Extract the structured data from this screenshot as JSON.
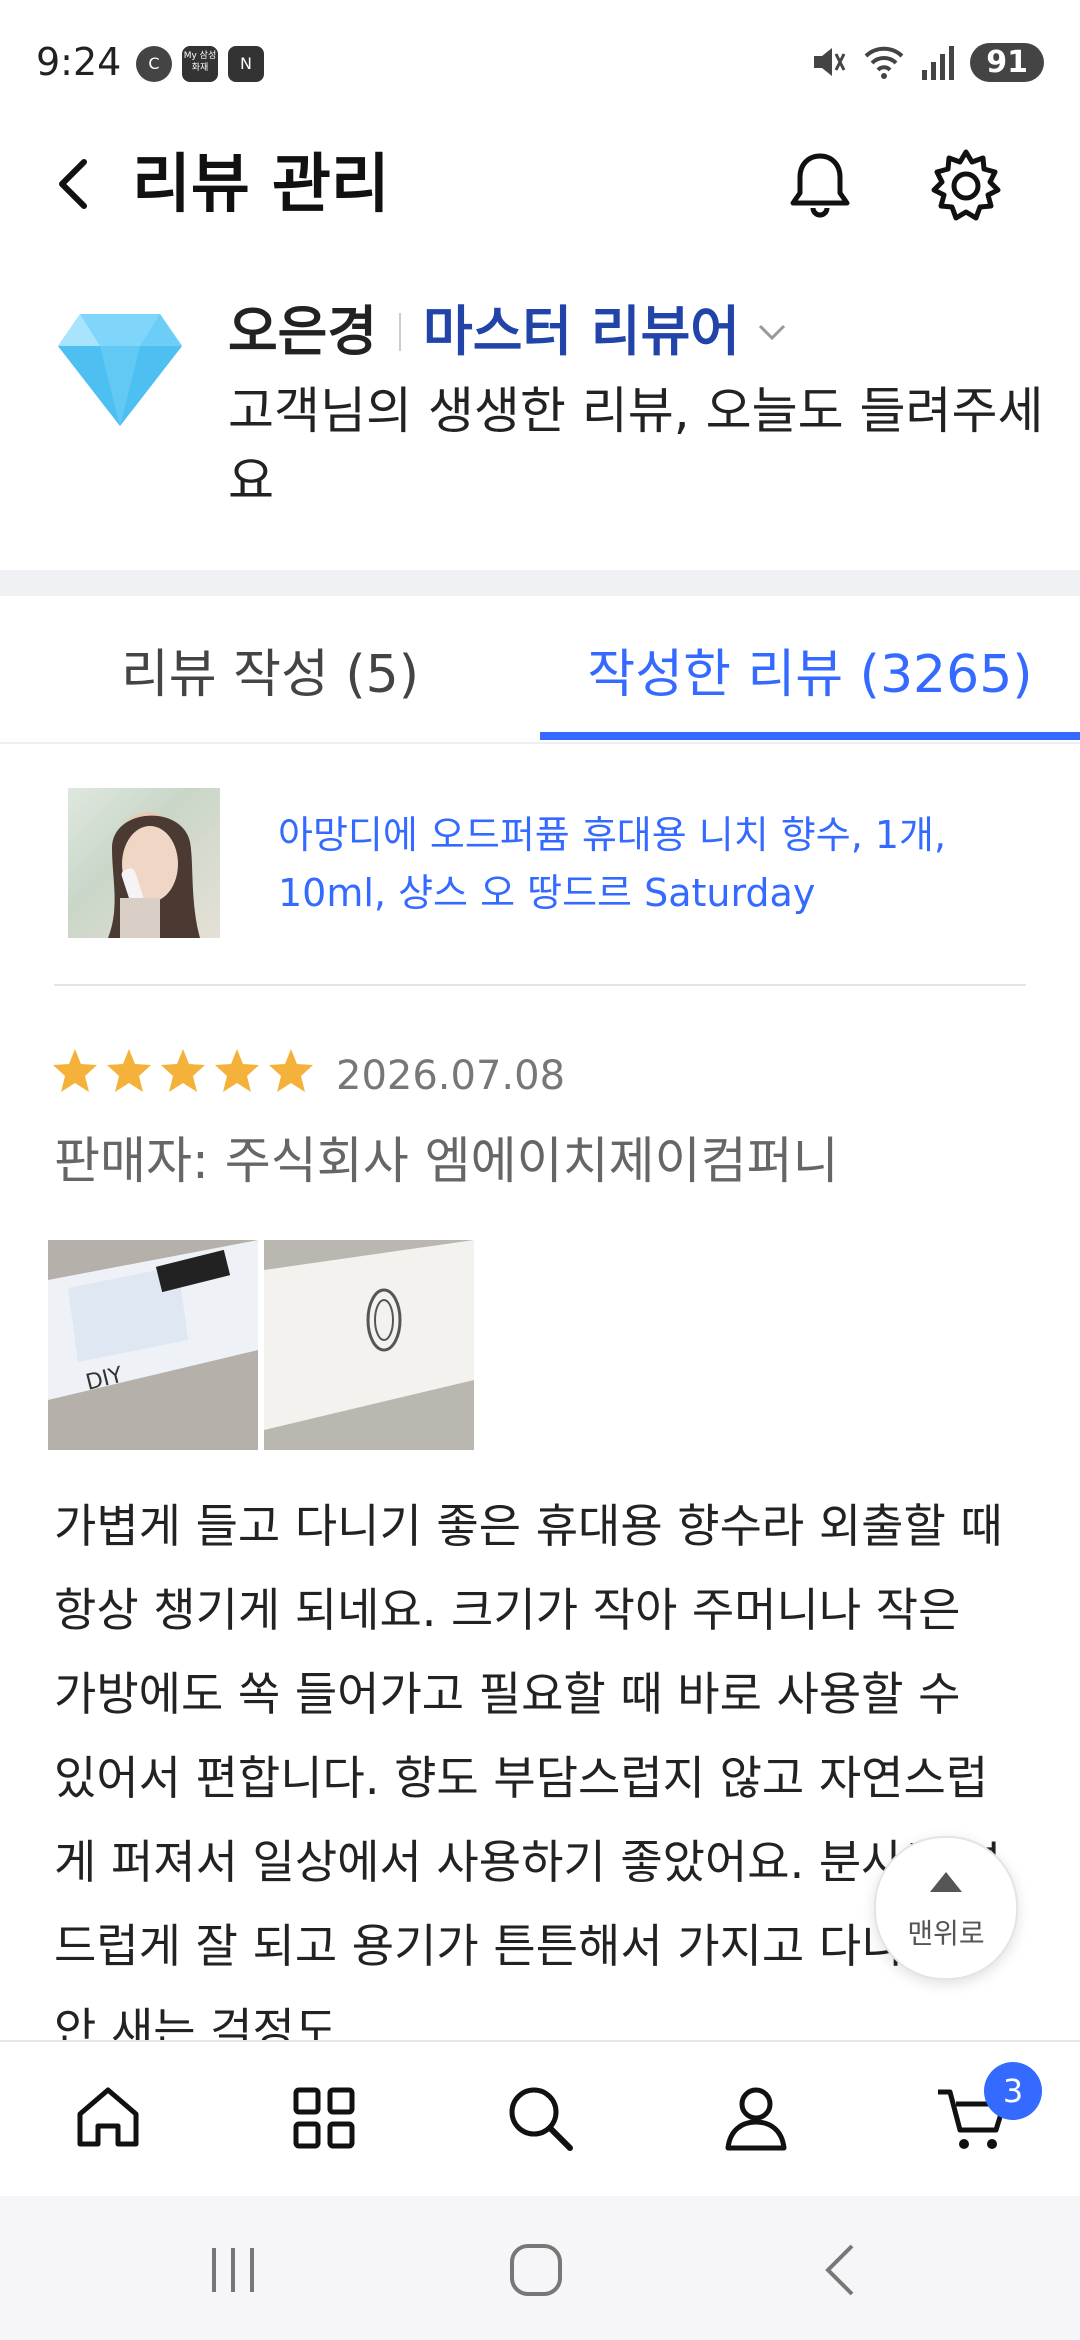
{
  "status_bar": {
    "time": "9:24",
    "badges": [
      "C",
      "My 삼성화재",
      "N"
    ],
    "battery": "91"
  },
  "header": {
    "title": "리뷰 관리",
    "icons": [
      "back-icon",
      "bell-icon",
      "gear-icon"
    ]
  },
  "profile": {
    "name": "오은경",
    "grade": "마스터 리뷰어",
    "message": "고객님의 생생한 리뷰, 오늘도 들려주세요",
    "grade_icon": "diamond-icon"
  },
  "tabs": [
    {
      "label": "리뷰 작성 (5)",
      "active": false
    },
    {
      "label": "작성한 리뷰 (3265)",
      "active": true
    }
  ],
  "review": {
    "product_name": "아망디에 오드퍼퓸 휴대용 니치 향수, 1개, 10ml, 샹스 오 땅드르 Saturday",
    "rating": 5,
    "date": "2026.07.08",
    "seller": "판매자: 주식회사 엠에이치제이컴퍼니",
    "photo_count": 2,
    "text": "가볍게 들고 다니기 좋은 휴대용 향수라 외출할 때 항상 챙기게 되네요. 크기가 작아 주머니나 작은 가방에도 쏙 들어가고 필요할 때 바로 사용할 수 있어서 편합니다. 향도 부담스럽지 않고 자연스럽게 퍼져서 일상에서 사용하기 좋았어요. 분사도 부드럽게 잘 되고 용기가 튼튼해서 가지고 다니는 동안 새는 걱정도"
  },
  "scroll_top_label": "맨위로",
  "bottom_nav": {
    "items": [
      "home-icon",
      "categories-icon",
      "search-icon",
      "my-account-icon",
      "cart-icon"
    ],
    "cart_count": "3"
  },
  "colors": {
    "accent": "#346aff",
    "grade": "#2244a8",
    "star": "#f4b23b",
    "diamond": "#5cc8f5"
  }
}
